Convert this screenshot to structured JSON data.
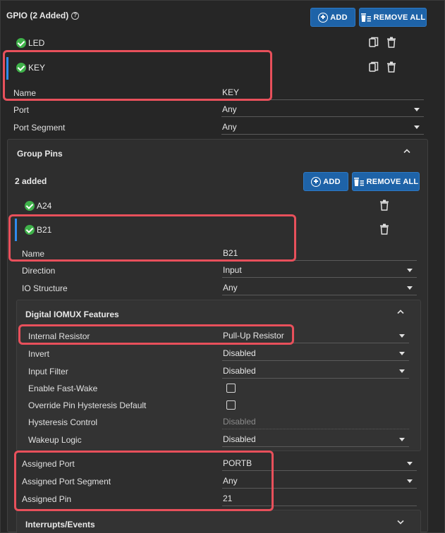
{
  "header": {
    "title": "GPIO (2 Added)",
    "add_label": "ADD",
    "remove_all_label": "REMOVE ALL"
  },
  "gpio_items": [
    {
      "label": "LED"
    },
    {
      "label": "KEY"
    }
  ],
  "gpio_fields": {
    "name_label": "Name",
    "name_value": "KEY",
    "port_label": "Port",
    "port_value": "Any",
    "segment_label": "Port Segment",
    "segment_value": "Any"
  },
  "group_pins": {
    "title": "Group Pins",
    "count_text": "2 added",
    "add_label": "ADD",
    "remove_all_label": "REMOVE ALL",
    "items": [
      {
        "label": "A24"
      },
      {
        "label": "B21"
      }
    ],
    "name_label": "Name",
    "name_value": "B21",
    "direction_label": "Direction",
    "direction_value": "Input",
    "io_label": "IO Structure",
    "io_value": "Any"
  },
  "iomux": {
    "title": "Digital IOMUX Features",
    "internal_resistor_label": "Internal Resistor",
    "internal_resistor_value": "Pull-Up Resistor",
    "invert_label": "Invert",
    "invert_value": "Disabled",
    "input_filter_label": "Input Filter",
    "input_filter_value": "Disabled",
    "fast_wake_label": "Enable Fast-Wake",
    "override_label": "Override Pin Hysteresis Default",
    "hysteresis_label": "Hysteresis Control",
    "hysteresis_value": "Disabled",
    "wakeup_label": "Wakeup Logic",
    "wakeup_value": "Disabled"
  },
  "assigned": {
    "port_label": "Assigned Port",
    "port_value": "PORTB",
    "segment_label": "Assigned Port Segment",
    "segment_value": "Any",
    "pin_label": "Assigned Pin",
    "pin_value": "21"
  },
  "interrupts": {
    "title": "Interrupts/Events"
  },
  "colors": {
    "accent": "#1e63a8",
    "selection": "#2e8bf0",
    "highlight": "#e8505b",
    "check": "#3fb24a"
  }
}
